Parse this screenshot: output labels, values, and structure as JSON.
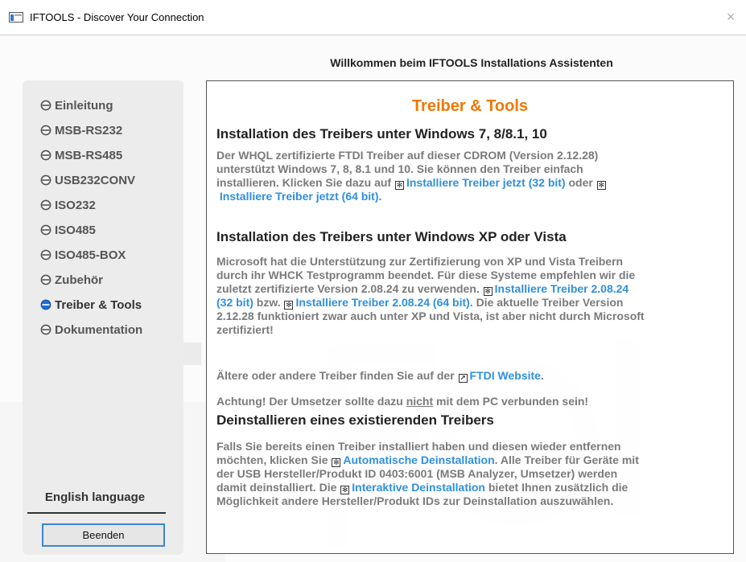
{
  "window": {
    "title": "IFTOOLS - Discover Your Connection",
    "close_glyph": "×"
  },
  "header": {
    "text": "Willkommen beim IFTOOLS Installations Assistenten"
  },
  "sidebar": {
    "items": [
      {
        "label": "Einleitung",
        "active": false
      },
      {
        "label": "MSB-RS232",
        "active": false
      },
      {
        "label": "MSB-RS485",
        "active": false
      },
      {
        "label": "USB232CONV",
        "active": false
      },
      {
        "label": "ISO232",
        "active": false
      },
      {
        "label": "ISO485",
        "active": false
      },
      {
        "label": "ISO485-BOX",
        "active": false
      },
      {
        "label": "Zubehör",
        "active": false
      },
      {
        "label": "Treiber & Tools",
        "active": true
      },
      {
        "label": "Dokumentation",
        "active": false
      }
    ],
    "english_label": "English language",
    "quit_label": "Beenden"
  },
  "content": {
    "title": "Treiber & Tools",
    "s1": {
      "heading": "Installation des Treibers unter Windows 7, 8/8.1, 10",
      "l1": "Der WHQL zertifizierte FTDI Treiber auf dieser CDROM (Version 2.12.28)",
      "l2": "unterstützt Windows 7, 8, 8.1 und 10. Sie können den Treiber einfach",
      "l3a": "installieren. Klicken Sie dazu auf",
      "link32": "Installiere Treiber jetzt (32 bit)",
      "l3b": " oder",
      "link64": "Installiere Treiber jetzt (64 bit).",
      "l4pre": ""
    },
    "s2": {
      "heading": "Installation des Treibers unter Windows XP oder Vista",
      "l1": "Microsoft hat die Unterstützung zur Zertifizierung von XP und Vista Treibern",
      "l2": "durch ihr WHCK Testprogramm beendet. Für diese Systeme empfehlen wir die",
      "l3a": "zuletzt zertifizierte Version 2.08.24 zu verwenden.",
      "link32a": "Installiere Treiber 2.08.24",
      "link32b": "(32 bit)",
      "l4a": " bzw.",
      "link64": "Installiere Treiber 2.08.24 (64 bit).",
      "l4b": " Die aktuelle Treiber Version",
      "l5": "2.12.28 funktioniert zwar auch unter XP und Vista, ist aber nicht durch Microsoft",
      "l6": "zertifiziert!"
    },
    "older_pre": "Ältere oder andere Treiber finden Sie auf der",
    "ftdi_link": "FTDI Website",
    "older_post": ".",
    "warn_pre": "Achtung! Der Umsetzer sollte dazu ",
    "warn_u": "nicht",
    "warn_post": " mit dem PC verbunden sein!",
    "s3": {
      "heading": "Deinstallieren eines existierenden Treibers",
      "l1": "Falls Sie bereits einen Treiber installiert haben und diesen wieder entfernen",
      "l2a": "möchten, klicken Sie",
      "link_auto": "Automatische Deinstallation",
      "l2b": ". Alle Treiber für Geräte mit",
      "l3": "der USB Hersteller/Produkt ID 0403:6001 (MSB Analyzer, Umsetzer) werden",
      "l4a": "damit deinstalliert. Die",
      "link_inter": "Interaktive Deinstallation",
      "l4b": " bietet Ihnen zusätzlich die",
      "l5": "Möglichkeit andere Hersteller/Produkt IDs zur Deinstallation auszuwählen."
    },
    "link_icon": "✻",
    "web_icon": "↗"
  },
  "colors": {
    "accent_orange": "#f07800",
    "link_blue": "#2f8fe0",
    "active_radio": "#1a6fd6",
    "button_border": "#3c86d4"
  }
}
